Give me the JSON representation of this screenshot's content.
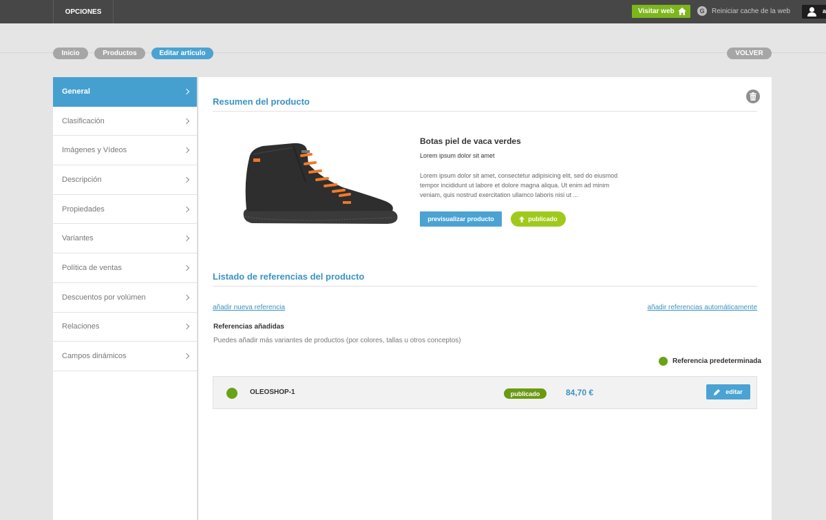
{
  "topbar": {
    "menu_label": "OPCIONES",
    "visit_label": "Visitar web",
    "reset_label": "Reiniciar cache de la web",
    "reset_icon_letter": "G",
    "user_initial": "a"
  },
  "breadcrumb": {
    "items": [
      "Inicio",
      "Productos",
      "Editar artículo"
    ],
    "back_label": "VOLVER"
  },
  "sidebar": {
    "items": [
      {
        "label": "General",
        "active": true
      },
      {
        "label": "Clasificación"
      },
      {
        "label": "Imágenes y Vídeos"
      },
      {
        "label": "Descripción"
      },
      {
        "label": "Propiedades"
      },
      {
        "label": "Variantes"
      },
      {
        "label": "Política de ventas"
      },
      {
        "label": "Descuentos por volúmen"
      },
      {
        "label": "Relaciones"
      },
      {
        "label": "Campos dinámicos"
      }
    ]
  },
  "summary": {
    "title": "Resumen del producto",
    "product_name": "Botas piel de vaca verdes",
    "subtitle": "Lorem ipsum dolor sit amet",
    "description": "Lorem ipsum dolor sit amet, consectetur adipisicing elit, sed do eiusmod tempor incididunt ut labore et dolore magna aliqua. Ut enim ad minim veniam, quis nostrud exercitation ullamco laboris nisi ut ...",
    "preview_label": "previsualizar producto",
    "published_label": "publicado"
  },
  "references": {
    "title": "Listado de referencias del producto",
    "add_link": "añadir nueva referencia",
    "auto_link": "añadir referencias automáticamente",
    "heading": "Referencias añadidas",
    "help": "Puedes añadir más variantes de productos (por colores, tallas u otros conceptos)",
    "legend": "Referencia predeterminada",
    "rows": [
      {
        "code": "OLEOSHOP-1",
        "status": "publicado",
        "price": "84,70 €",
        "edit_label": "editar"
      }
    ]
  },
  "colors": {
    "accent_blue": "#4aa3d2",
    "green": "#7cb61b",
    "topbar": "#474747"
  }
}
